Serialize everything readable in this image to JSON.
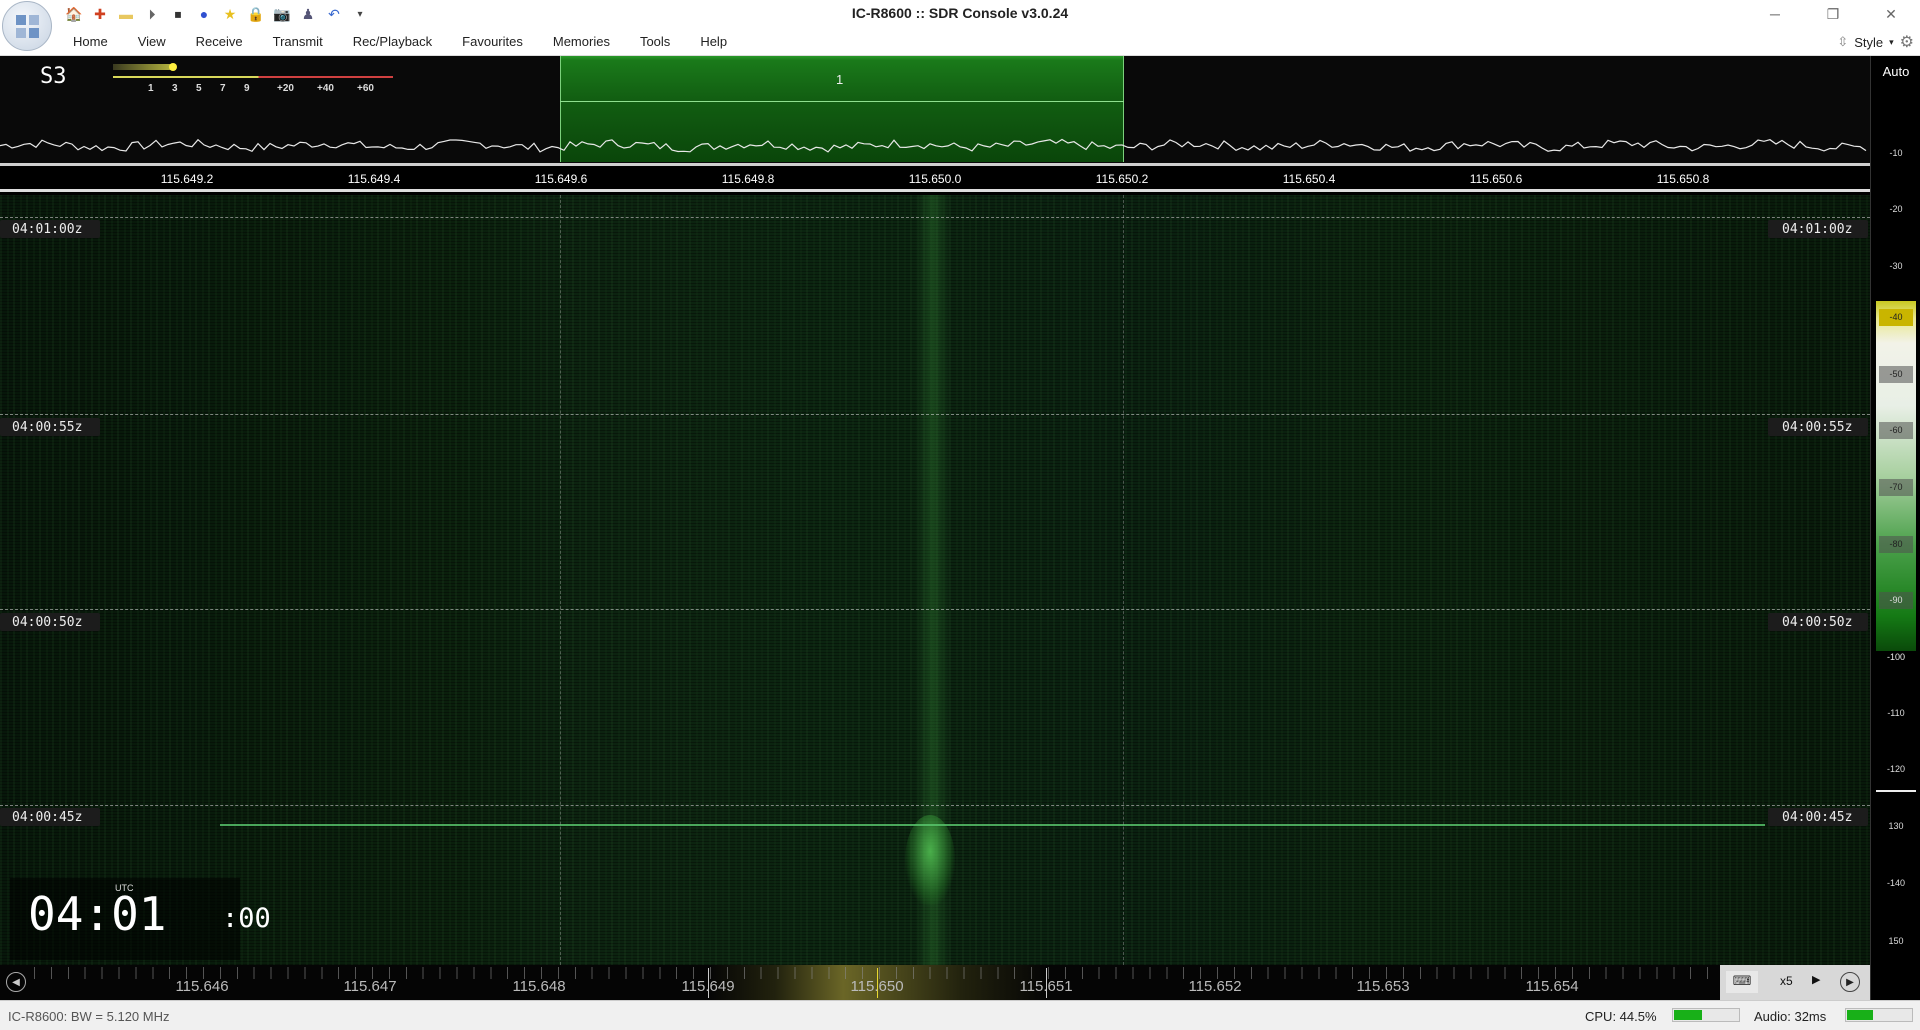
{
  "window": {
    "title": "IC-R8600 :: SDR Console v3.0.24",
    "minimize": "─",
    "maximize": "❐",
    "close": "✕"
  },
  "quick_access": [
    "home-icon",
    "lifebuoy-icon",
    "folder-icon",
    "play-icon",
    "stop-icon",
    "record-icon",
    "star-icon",
    "lock-icon",
    "camera-icon",
    "user-icon",
    "undo-icon",
    "dropdown-icon"
  ],
  "menu": {
    "items": [
      "Home",
      "View",
      "Receive",
      "Transmit",
      "Rec/Playback",
      "Favourites",
      "Memories",
      "Tools",
      "Help"
    ],
    "style_label": "Style"
  },
  "smeter": {
    "value": "S3",
    "scale": [
      "1",
      "3",
      "5",
      "7",
      "9",
      "+20",
      "+40",
      "+60"
    ],
    "level_fraction": 0.2
  },
  "spectrum": {
    "receiver_label": "1",
    "freq_labels": [
      "115.649.2",
      "115.649.4",
      "115.649.6",
      "115.649.8",
      "115.650.0",
      "115.650.2",
      "115.650.4",
      "115.650.6",
      "115.650.8"
    ]
  },
  "db_scale": {
    "auto_label": "Auto",
    "labels": [
      "-10",
      "-20",
      "-30",
      "-40",
      "-50",
      "-60",
      "-70",
      "-80",
      "-90",
      "-100",
      "-110",
      "-120",
      "130",
      "-140",
      "150"
    ]
  },
  "waterfall": {
    "timestamps": [
      "04:01:00z",
      "04:00:55z",
      "04:00:50z",
      "04:00:45z"
    ],
    "clock_utc_label": "UTC",
    "clock_hhmm": "04:01",
    "clock_sec": ":00"
  },
  "bottom_bar": {
    "freq_labels": [
      "115.646",
      "115.647",
      "115.648",
      "115.649",
      "115.650",
      "115.651",
      "115.652",
      "115.653",
      "115.654"
    ],
    "keyboard_icon": "⌨",
    "zoom": "x5",
    "zoom_arrow": "▶"
  },
  "status": {
    "left": "IC-R8600: BW = 5.120 MHz",
    "cpu": "CPU: 44.5%",
    "cpu_fraction": 0.445,
    "audio": "Audio: 32ms",
    "audio_fraction": 0.4
  },
  "colors": {
    "receiver_band": "#1a7a1a",
    "waterfall_signal": "#46b446",
    "meter_fill": "#18b018"
  }
}
